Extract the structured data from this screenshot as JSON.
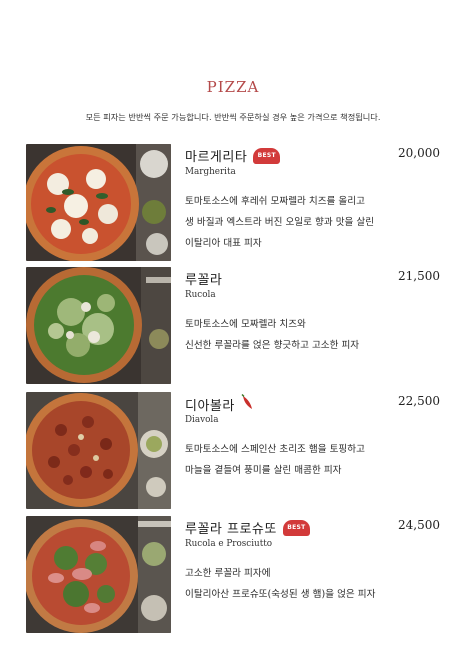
{
  "header": {
    "title": "PIZZA",
    "notice": "모든 피자는 반반씩 주문 가능합니다. 반반씩 주문하실 경우 높은 가격으로 책정됩니다."
  },
  "items": [
    {
      "name": "마르게리타",
      "eng": "Margherita",
      "price": "20,000",
      "badge": "BEST",
      "desc": [
        "토마토소스에 후레쉬 모짜렐라 치즈를 올리고",
        "생 바질과 엑스트라 버진 오일로 향과 맛을 살린",
        "이탈리아 대표 피자"
      ]
    },
    {
      "name": "루꼴라",
      "eng": "Rucola",
      "price": "21,500",
      "desc": [
        "토마토소스에 모짜렐라 치즈와",
        "신선한 루꼴라를 얹은 향긋하고 고소한 피자"
      ]
    },
    {
      "name": "디아볼라",
      "eng": "Diavola",
      "price": "22,500",
      "icon": "chili-pepper-icon",
      "desc": [
        "토마토소스에 스페인산 초리조 햄을 토핑하고",
        "마늘을 곁들여 풍미를 살린 매콤한 피자"
      ]
    },
    {
      "name": "루꼴라 프로슈또",
      "eng": "Rucola e Prosciutto",
      "price": "24,500",
      "badge": "BEST",
      "desc": [
        "고소한 루꼴라 피자에",
        "이탈리아산 프로슈또(숙성된 생 햄)을 얹은 피자"
      ]
    }
  ],
  "colors": {
    "title": "#b44a4a",
    "badge": "#d23a3a"
  }
}
